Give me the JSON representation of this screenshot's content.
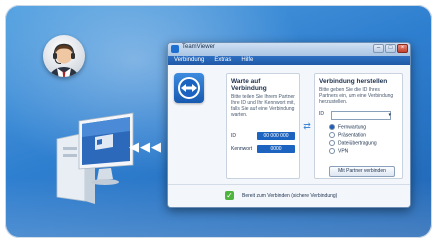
{
  "window": {
    "title": "TeamViewer",
    "menu": [
      "Verbindung",
      "Extras",
      "Hilfe"
    ],
    "controls": {
      "minimize": "–",
      "maximize": "□",
      "close": "×"
    }
  },
  "wait_panel": {
    "heading": "Warte auf Verbindung",
    "text": "Bitte teilen Sie Ihrem Partner Ihre ID und Ihr Kennwort mit, falls Sie auf eine Verbindung warten.",
    "id_label": "ID",
    "id_value": "00 000 000",
    "password_label": "Kennwort",
    "password_value": "0000"
  },
  "connect_panel": {
    "heading": "Verbindung herstellen",
    "text": "Bitte geben Sie die ID Ihres Partners ein, um eine Verbindung herzustellen.",
    "id_label": "ID",
    "id_value": "",
    "dropdown_arrow": "▾",
    "options": [
      {
        "label": "Fernwartung",
        "selected": true
      },
      {
        "label": "Präsentation",
        "selected": false
      },
      {
        "label": "Dateiübertragung",
        "selected": false
      },
      {
        "label": "VPN",
        "selected": false
      }
    ],
    "connect_button": "Mit Partner verbinden"
  },
  "status": {
    "check": "✓",
    "text": "Bereit zum Verbinden (sichere Verbindung)"
  },
  "decor": {
    "arrows": "◀◀◀",
    "swap": "⇄",
    "colors": {
      "background": "#2f7fd0",
      "accent": "#1d63c0",
      "status_ok": "#4fb33f"
    }
  }
}
